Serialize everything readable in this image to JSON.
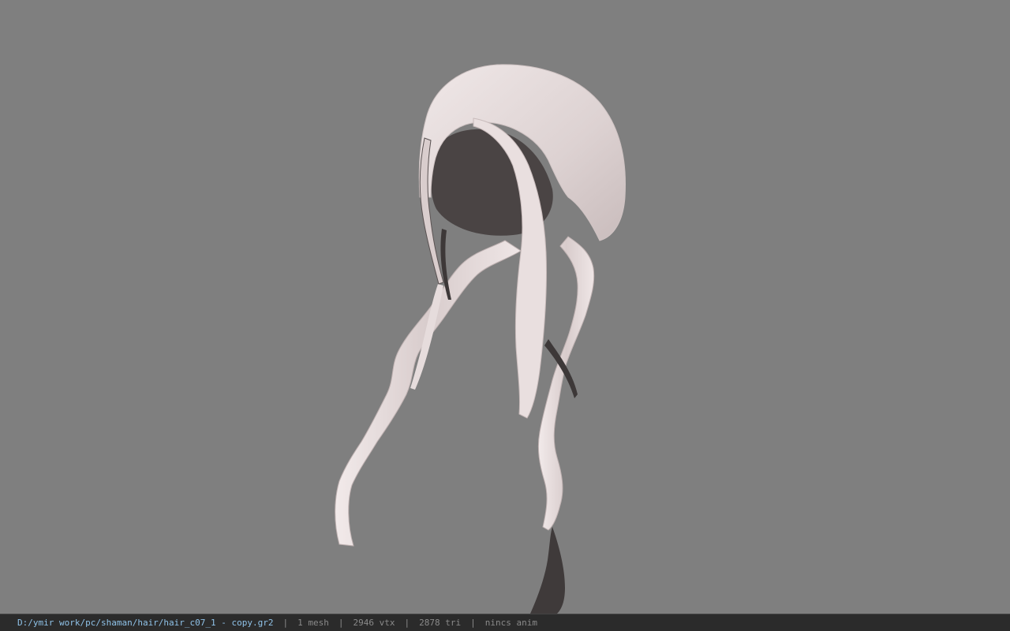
{
  "viewport": {
    "background": "#7f7f7f",
    "model": "hair-mesh"
  },
  "status": {
    "path": "D:/ymir work/pc/shaman/hair/hair_c07_1 - copy.gr2",
    "mesh": "1 mesh",
    "vertices": "2946 vtx",
    "triangles": "2878 tri",
    "anim": "nincs anim",
    "separator": "|"
  },
  "colors": {
    "status_bg": "#2b2b2b",
    "path_text": "#8fc2e8",
    "stat_text": "#8a8a8a",
    "hair_light": "#e8dede",
    "hair_shadow": "#4a4444"
  }
}
